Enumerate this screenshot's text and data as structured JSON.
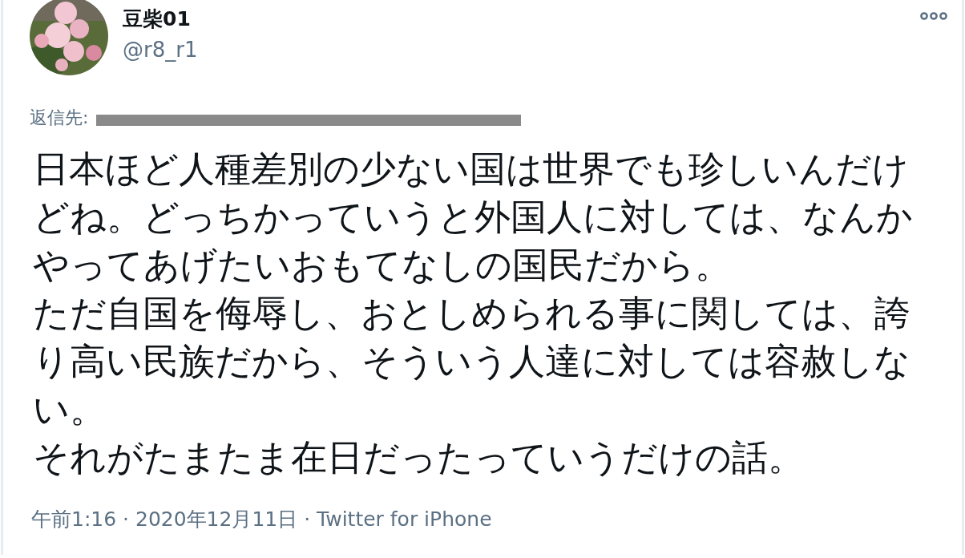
{
  "author": {
    "display_name": "豆柴01",
    "handle": "@r8_r1"
  },
  "reply_to": {
    "label": "返信先:",
    "redacted": true
  },
  "paragraphs": [
    "日本ほど人種差別の少ない国は世界でも珍しいんだけどね。どっちかっていうと外国人に対しては、なんかやってあげたいおもてなしの国民だから。",
    "ただ自国を侮辱し、おとしめられる事に関しては、誇り高い民族だから、そういう人達に対しては容赦しない。",
    "それがたまたま在日だったっていうだけの話。"
  ],
  "meta": "午前1:16 · 2020年12月11日 · Twitter for iPhone"
}
